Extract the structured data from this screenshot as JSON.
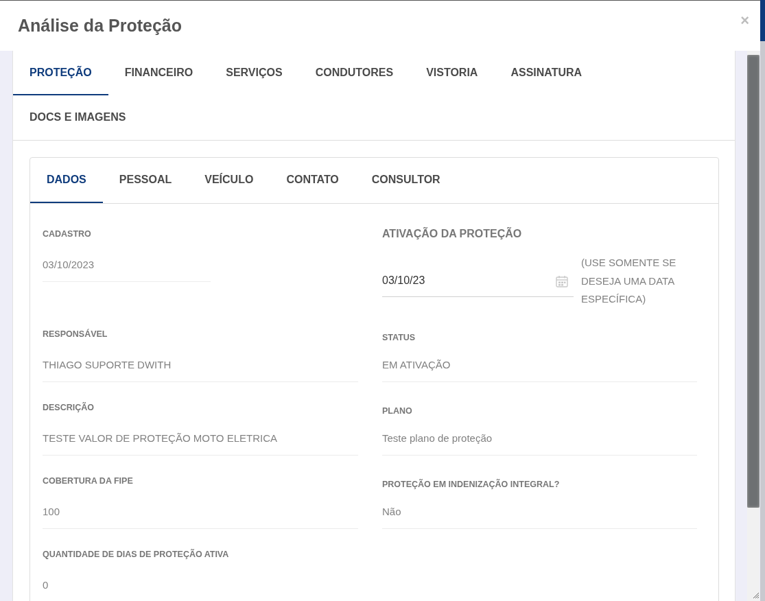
{
  "dialog": {
    "title": "Análise da Proteção",
    "close": "×"
  },
  "tabs": [
    {
      "label": "PROTEÇÃO",
      "selected": true
    },
    {
      "label": "FINANCEIRO",
      "selected": false
    },
    {
      "label": "SERVIÇOS",
      "selected": false
    },
    {
      "label": "CONDUTORES",
      "selected": false
    },
    {
      "label": "VISTORIA",
      "selected": false
    },
    {
      "label": "ASSINATURA",
      "selected": false
    },
    {
      "label": "DOCS E IMAGENS",
      "selected": false
    }
  ],
  "subtabs": [
    {
      "label": "DADOS",
      "selected": true
    },
    {
      "label": "PESSOAL",
      "selected": false
    },
    {
      "label": "VEÍCULO",
      "selected": false
    },
    {
      "label": "CONTATO",
      "selected": false
    },
    {
      "label": "CONSULTOR",
      "selected": false
    }
  ],
  "fields": [
    {
      "kind": "short",
      "label": "CADASTRO",
      "value": "03/10/2023"
    },
    {
      "kind": "date",
      "label": "ATIVAÇÃO DA PROTEÇÃO",
      "value": "03/10/23",
      "hint": "(USE SOMENTE SE DESEJA UMA DATA ESPECÍFICA)"
    },
    {
      "kind": "text",
      "label": "RESPONSÁVEL",
      "value": "THIAGO SUPORTE DWITH"
    },
    {
      "kind": "text",
      "label": "STATUS",
      "value": "EM ATIVAÇÃO"
    },
    {
      "kind": "text",
      "label": "DESCRIÇÃO",
      "value": "TESTE VALOR DE PROTEÇÃO MOTO ELETRICA"
    },
    {
      "kind": "text",
      "label": "PLANO",
      "value": "Teste plano de proteção"
    },
    {
      "kind": "text",
      "label": "COBERTURA DA FIPE",
      "value": "100"
    },
    {
      "kind": "text",
      "label": "PROTEÇÃO EM INDENIZAÇÃO INTEGRAL?",
      "value": "Não"
    },
    {
      "kind": "text",
      "label": "QUANTIDADE DE DIAS DE PROTEÇÃO ATIVA",
      "value": "0"
    }
  ]
}
